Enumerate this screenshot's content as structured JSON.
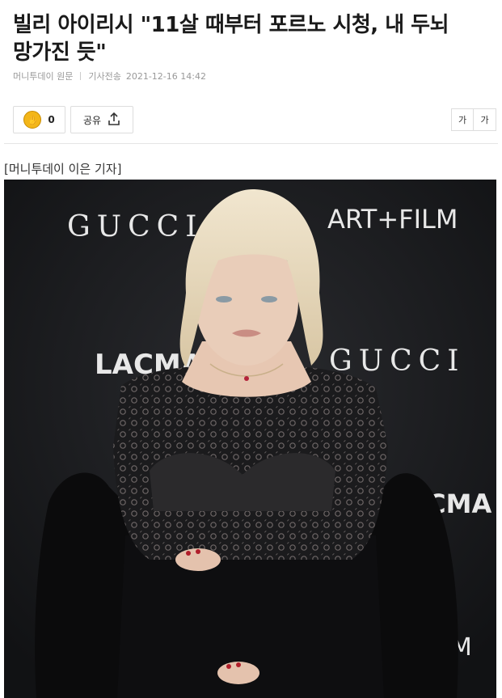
{
  "article": {
    "headline": "빌리 아이리시 \"11살 때부터 포르노 시청, 내 두뇌 망가진 듯\"",
    "source_label": "머니투데이 원문",
    "stamp_label": "기사전송",
    "timestamp": "2021-12-16 14:42",
    "byline": "[머니투데이 이은 기자]"
  },
  "toolbar": {
    "like_count": "0",
    "share_label": "공유",
    "font_smaller": "가",
    "font_larger": "가"
  },
  "icons": {
    "like": "like-emoji-icon",
    "share": "share-upload-icon"
  },
  "photo": {
    "backdrop_text": {
      "gucci_top": "GUCCI",
      "artfilm_top": "ART+FILM",
      "lacma_left": "LACMA",
      "gucci_right": "GUCCI",
      "lacma_right": "LACMA",
      "film_bottom": "FILM"
    }
  },
  "colors": {
    "accent": "#f3b619",
    "backdrop": "#16171a"
  }
}
